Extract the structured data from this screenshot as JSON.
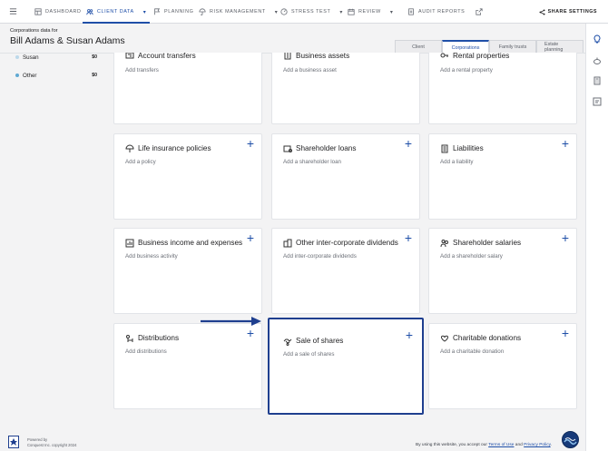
{
  "nav": {
    "items": [
      {
        "label": "Dashboard",
        "icon": "grid-icon"
      },
      {
        "label": "Client data",
        "icon": "users-icon",
        "active": true,
        "has_menu": true
      },
      {
        "label": "Planning",
        "icon": "flag-icon"
      },
      {
        "label": "Risk management",
        "icon": "umbrella-icon",
        "has_menu": true
      },
      {
        "label": "Stress test",
        "icon": "gauge-icon",
        "has_menu": true
      },
      {
        "label": "Review",
        "icon": "calendar-icon",
        "has_menu": true
      },
      {
        "label": "Audit reports",
        "icon": "report-icon",
        "external": true
      }
    ],
    "share_label": "SHARE SETTINGS",
    "accent": "#1f4fa8"
  },
  "header": {
    "subtitle": "Corporations data for",
    "client_name": "Bill Adams & Susan Adams"
  },
  "tabs": [
    "Client",
    "Corporations",
    "Family trusts",
    "Estate planning"
  ],
  "active_tab": "Corporations",
  "sidebar": {
    "items": [
      {
        "label": "Susan",
        "amount": "$0",
        "color": "#bcd9ea"
      },
      {
        "label": "Other",
        "amount": "$0",
        "color": "#5fa8d3"
      }
    ]
  },
  "cards": [
    {
      "title": "Account transfers",
      "subtitle": "Add transfers",
      "icon": "transfer-icon"
    },
    {
      "title": "Business assets",
      "subtitle": "Add a business asset",
      "icon": "building-icon"
    },
    {
      "title": "Rental properties",
      "subtitle": "Add a rental property",
      "icon": "rental-key-icon"
    },
    {
      "title": "Life insurance policies",
      "subtitle": "Add a policy",
      "icon": "umbrella-hand-icon"
    },
    {
      "title": "Shareholder loans",
      "subtitle": "Add a shareholder loan",
      "icon": "loan-icon"
    },
    {
      "title": "Liabilities",
      "subtitle": "Add a liability",
      "icon": "ledger-icon"
    },
    {
      "title": "Business income and expenses",
      "subtitle": "Add business activity",
      "icon": "income-icon"
    },
    {
      "title": "Other inter-corporate dividends",
      "subtitle": "Add inter-corporate dividends",
      "icon": "dividend-icon"
    },
    {
      "title": "Shareholder salaries",
      "subtitle": "Add a shareholder salary",
      "icon": "salary-people-icon"
    },
    {
      "title": "Distributions",
      "subtitle": "Add distributions",
      "icon": "distribution-icon"
    },
    {
      "title": "Sale of shares",
      "subtitle": "Add a sale of shares",
      "icon": "handshake-icon",
      "highlighted": true
    },
    {
      "title": "Charitable donations",
      "subtitle": "Add a charitable donation",
      "icon": "donation-icon"
    }
  ],
  "add_symbol": "+",
  "footer": {
    "powered_line1": "Powered by",
    "powered_line2": "Conquest Inc. copyright 2024",
    "legal_prefix": "By using this website, you accept our",
    "terms_label": "Terms of Use",
    "and": "and",
    "privacy_label": "Privacy Policy",
    "period": "."
  },
  "rail_icons": [
    "lightbulb-icon",
    "piggy-bank-icon",
    "calculator-icon",
    "notes-icon"
  ],
  "highlight_color": "#1f3f8f"
}
